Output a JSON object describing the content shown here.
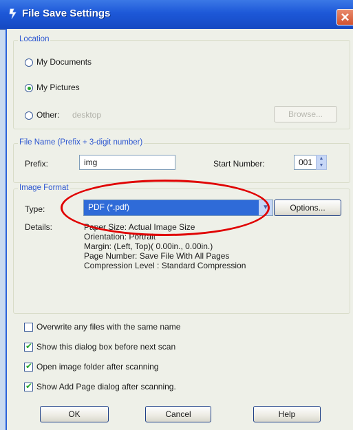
{
  "window": {
    "title": "File Save Settings",
    "close_symbol": "✕"
  },
  "location": {
    "group_title": "Location",
    "options": [
      {
        "label": "My Documents",
        "checked": false
      },
      {
        "label": "My Pictures",
        "checked": true
      },
      {
        "label": "Other:",
        "checked": false
      }
    ],
    "other_path": "desktop",
    "browse_label": "Browse..."
  },
  "file_name": {
    "group_title": "File Name (Prefix + 3-digit number)",
    "prefix_label": "Prefix:",
    "prefix_value": "img",
    "start_number_label": "Start Number:",
    "start_number_value": "001"
  },
  "image_format": {
    "group_title": "Image Format",
    "type_label": "Type:",
    "type_value": "PDF (*.pdf)",
    "options_label": "Options...",
    "details_label": "Details:",
    "details": [
      "Paper Size: Actual Image Size",
      "Orientation: Portrait",
      "Margin: (Left, Top)( 0.00in., 0.00in.)",
      "Page Number: Save File With All Pages",
      "Compression Level : Standard Compression"
    ]
  },
  "checkboxes": [
    {
      "label": "Overwrite any files with the same name",
      "checked": false
    },
    {
      "label": "Show this dialog box before next scan",
      "checked": true
    },
    {
      "label": "Open image folder after scanning",
      "checked": true
    },
    {
      "label": "Show Add Page dialog after scanning.",
      "checked": true
    }
  ],
  "buttons": {
    "ok": "OK",
    "cancel": "Cancel",
    "help": "Help"
  },
  "colors": {
    "titlebar": "#1d58d8",
    "group_title": "#2c56d0",
    "selection": "#2f6bd8",
    "annotation": "#e00000"
  }
}
